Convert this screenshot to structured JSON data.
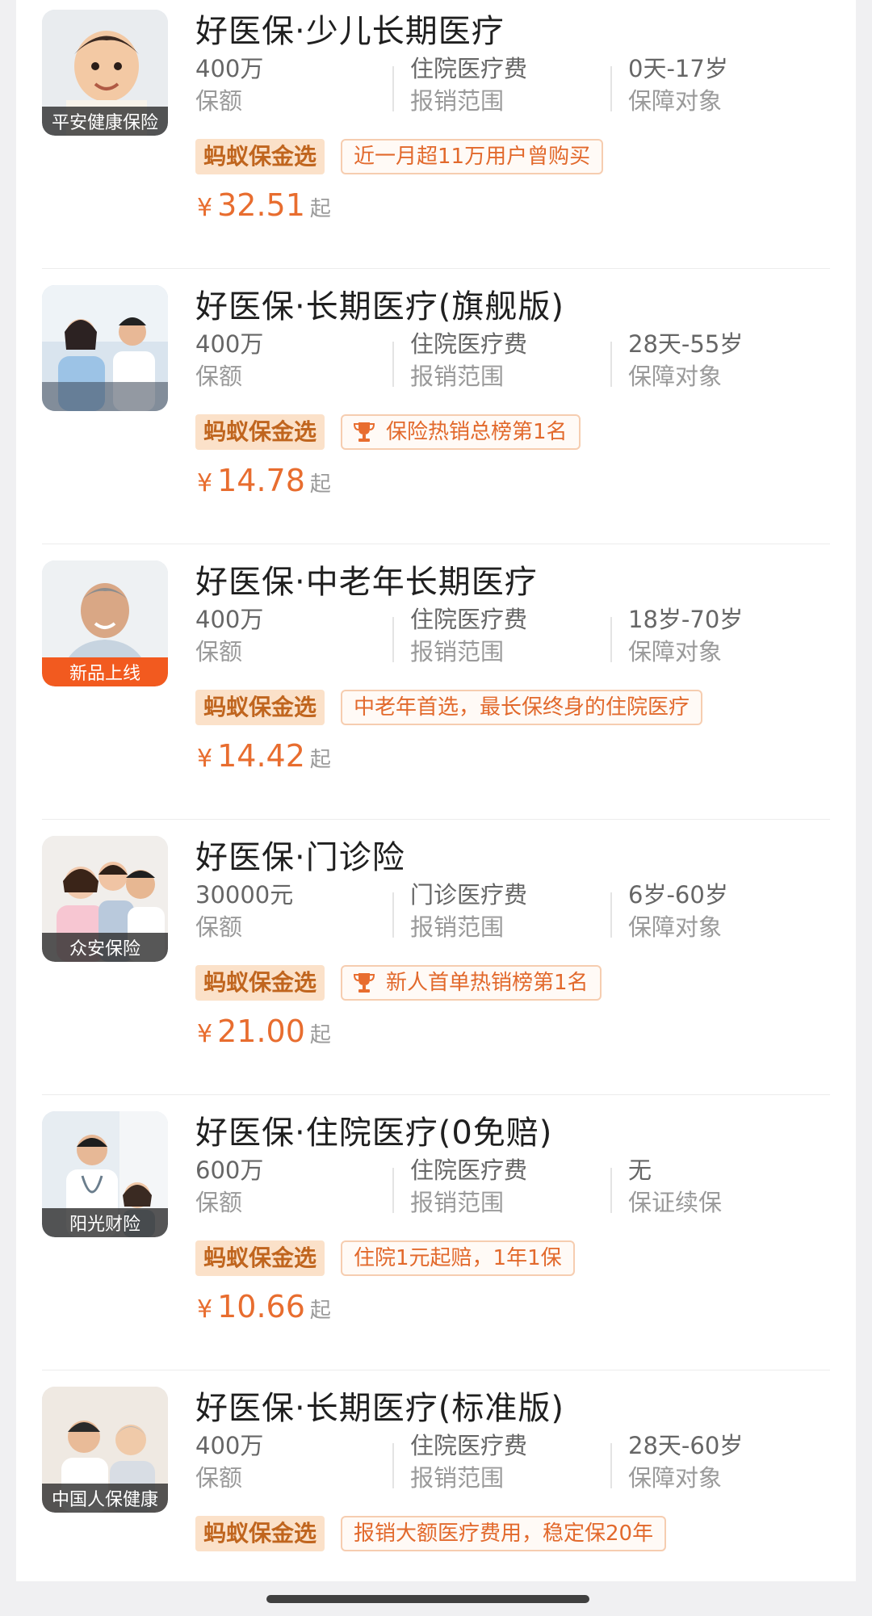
{
  "products": [
    {
      "title": "好医保·少儿长期医疗",
      "thumb_badge": "平安健康保险",
      "coverage_value": "400万",
      "coverage_label": "保额",
      "scope_value": "住院医疗费",
      "scope_label": "报销范围",
      "target_value": "0天-17岁",
      "target_label": "保障对象",
      "gold_tag": "蚂蚁保金选",
      "highlight": "近一月超11万用户曾购买",
      "currency": "¥",
      "price": "32.51",
      "price_suffix": "起"
    },
    {
      "title": "好医保·长期医疗(旗舰版)",
      "thumb_badge": "",
      "coverage_value": "400万",
      "coverage_label": "保额",
      "scope_value": "住院医疗费",
      "scope_label": "报销范围",
      "target_value": "28天-55岁",
      "target_label": "保障对象",
      "gold_tag": "蚂蚁保金选",
      "highlight": "保险热销总榜第1名",
      "currency": "¥",
      "price": "14.78",
      "price_suffix": "起"
    },
    {
      "title": "好医保·中老年长期医疗",
      "thumb_badge": "新品上线",
      "coverage_value": "400万",
      "coverage_label": "保额",
      "scope_value": "住院医疗费",
      "scope_label": "报销范围",
      "target_value": "18岁-70岁",
      "target_label": "保障对象",
      "gold_tag": "蚂蚁保金选",
      "highlight": "中老年首选，最长保终身的住院医疗",
      "currency": "¥",
      "price": "14.42",
      "price_suffix": "起"
    },
    {
      "title": "好医保·门诊险",
      "thumb_badge": "众安保险",
      "coverage_value": "30000元",
      "coverage_label": "保额",
      "scope_value": "门诊医疗费",
      "scope_label": "报销范围",
      "target_value": "6岁-60岁",
      "target_label": "保障对象",
      "gold_tag": "蚂蚁保金选",
      "highlight": "新人首单热销榜第1名",
      "currency": "¥",
      "price": "21.00",
      "price_suffix": "起"
    },
    {
      "title": "好医保·住院医疗(0免赔)",
      "thumb_badge": "阳光财险",
      "coverage_value": "600万",
      "coverage_label": "保额",
      "scope_value": "住院医疗费",
      "scope_label": "报销范围",
      "target_value": "无",
      "target_label": "保证续保",
      "gold_tag": "蚂蚁保金选",
      "highlight": "住院1元起赔，1年1保",
      "currency": "¥",
      "price": "10.66",
      "price_suffix": "起"
    },
    {
      "title": "好医保·长期医疗(标准版)",
      "thumb_badge": "中国人保健康",
      "coverage_value": "400万",
      "coverage_label": "保额",
      "scope_value": "住院医疗费",
      "scope_label": "报销范围",
      "target_value": "28天-60岁",
      "target_label": "保障对象",
      "gold_tag": "蚂蚁保金选",
      "highlight": "报销大额医疗费用，稳定保20年"
    }
  ],
  "icons": {
    "trophy": "trophy-icon"
  },
  "colors": {
    "accent": "#e86d2f",
    "gold_tag_bg": "#fbe1c9",
    "badge_orange": "#f25a1f"
  }
}
